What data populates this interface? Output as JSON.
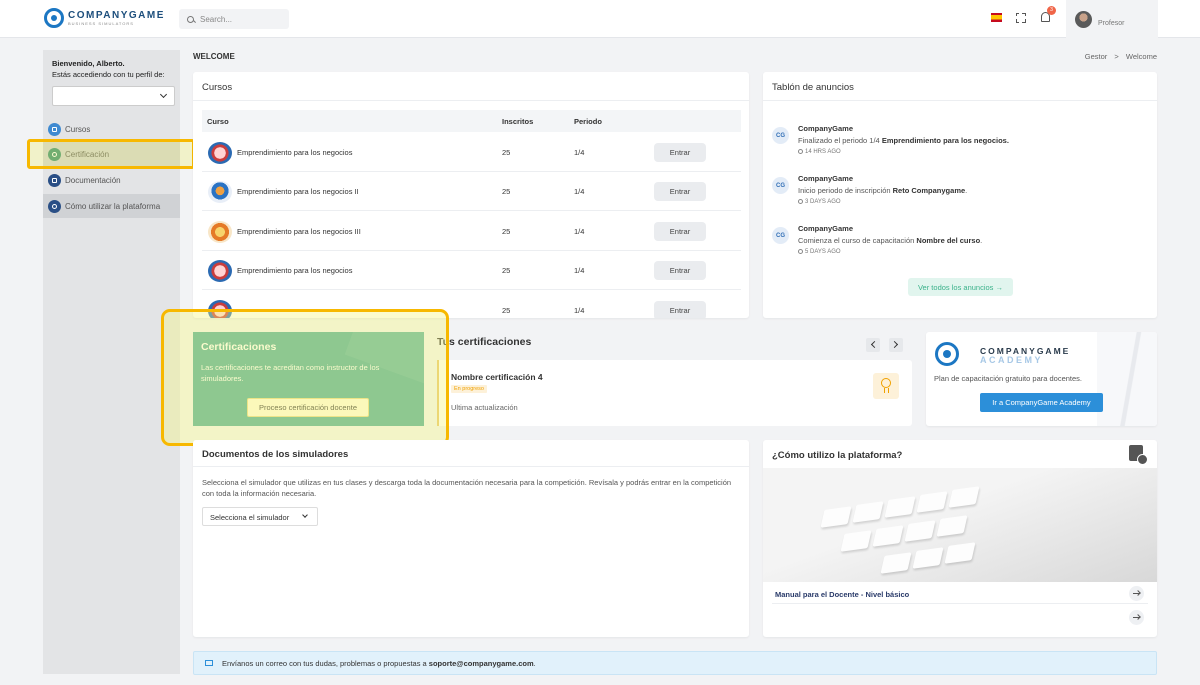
{
  "header": {
    "logo_name": "COMPANYGAME",
    "logo_sub": "BUSINESS SIMULATORS",
    "search_placeholder": "Search...",
    "notification_count": "3",
    "user_role": "Profesor"
  },
  "sidebar": {
    "greeting": "Bienvenido, Alberto.",
    "profile_prompt": "Estás accediendo con tu perfil de:",
    "items": [
      {
        "label": "Cursos",
        "icon": "book-icon"
      },
      {
        "label": "Certificación",
        "icon": "certificate-icon"
      },
      {
        "label": "Documentación",
        "icon": "folder-icon"
      },
      {
        "label": "Cómo utilizar la plataforma",
        "icon": "help-icon"
      }
    ]
  },
  "page": {
    "title": "WELCOME",
    "breadcrumb": [
      "Gestor",
      "Welcome"
    ],
    "breadcrumb_sep": ">"
  },
  "cursos": {
    "title": "Cursos",
    "columns": [
      "Curso",
      "Inscritos",
      "Periodo"
    ],
    "rows": [
      {
        "name": "Emprendimiento para los negocios",
        "count": "25",
        "period": "1/4",
        "action": "Entrar"
      },
      {
        "name": "Emprendimiento para los negocios II",
        "count": "25",
        "period": "1/4",
        "action": "Entrar"
      },
      {
        "name": "Emprendimiento para los negocios III",
        "count": "25",
        "period": "1/4",
        "action": "Entrar"
      },
      {
        "name": "Emprendimiento para los negocios",
        "count": "25",
        "period": "1/4",
        "action": "Entrar"
      },
      {
        "name": "",
        "count": "25",
        "period": "1/4",
        "action": "Entrar"
      }
    ]
  },
  "tablon": {
    "title": "Tablón de anuncios",
    "avatar_initials": "CG",
    "items": [
      {
        "author": "CompanyGame",
        "text": "Finalizado el periodo 1/4 ",
        "bold": "Emprendimiento para los negocios.",
        "time": "14 HRS AGO"
      },
      {
        "author": "CompanyGame",
        "text": "Inicio periodo de inscripción ",
        "bold": "Reto Companygame",
        "tail": ".",
        "time": "3 DAYS AGO"
      },
      {
        "author": "CompanyGame",
        "text": "Comienza el curso de capacitación ",
        "bold": "Nombre del curso",
        "tail": ".",
        "time": "5 DAYS AGO"
      }
    ],
    "view_all": "Ver todos los anuncios →"
  },
  "cert_promo": {
    "title": "Certificaciones",
    "description": "Las certificaciones te acreditan como instructor de los simuladores.",
    "button": "Proceso certificación docente"
  },
  "tus_certificaciones": {
    "title": "Tus certificaciones",
    "item_name": "Nombre certificación 4",
    "status": "En progreso",
    "last_update": "Ultima actualización"
  },
  "academy": {
    "name": "COMPANYGAME",
    "sub": "ACADEMY",
    "description": "Plan de capacitación gratuito para docentes.",
    "button": "Ir a CompanyGame Academy"
  },
  "docs": {
    "title": "Documentos de los simuladores",
    "description": "Selecciona el simulador que utilizas en tus clases y descarga toda la documentación necesaria para la competición. Revísala y podrás entrar en la competición con toda la información necesaria.",
    "select_label": "Selecciona el simulador"
  },
  "como": {
    "title": "¿Cómo utilizo la plataforma?",
    "manual": "Manual para el Docente - Nivel básico",
    "second_row": ""
  },
  "banner": {
    "text": "Envíanos un correo con tus dudas, problemas o propuestas a ",
    "email": "soporte@companygame.com",
    "tail": "."
  }
}
